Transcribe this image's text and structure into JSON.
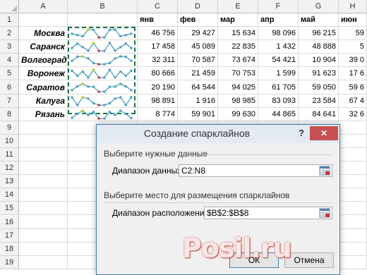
{
  "sheet": {
    "columns": [
      "A",
      "B",
      "C",
      "D",
      "E",
      "F",
      "G",
      "H"
    ],
    "rows": [
      "1",
      "2",
      "3",
      "4",
      "5",
      "6",
      "7",
      "8",
      "9",
      "10",
      "11",
      "12",
      "13",
      "14",
      "15",
      "16",
      "17",
      "18",
      "19"
    ],
    "months": [
      "янв",
      "фев",
      "мар",
      "апр",
      "май",
      "июн"
    ],
    "cities": [
      "Москва",
      "Саранск",
      "Волгоград",
      "Воронеж",
      "Саратов",
      "Калуга",
      "Рязань"
    ],
    "values": [
      [
        "46 756",
        "29 427",
        "15 634",
        "98 096",
        "96 215",
        "59"
      ],
      [
        "17 458",
        "45 089",
        "22 835",
        "1 432",
        "48 888",
        "5"
      ],
      [
        "32 311",
        "70 587",
        "73 674",
        "54 421",
        "10 904",
        "39 0"
      ],
      [
        "80 666",
        "21 459",
        "70 753",
        "1 599",
        "91 623",
        "17 6"
      ],
      [
        "20 190",
        "64 544",
        "94 025",
        "61 705",
        "59 050",
        "59 6"
      ],
      [
        "98 891",
        "1 916",
        "98 985",
        "83 093",
        "23 584",
        "67 4"
      ],
      [
        "8 774",
        "59 901",
        "99 630",
        "44 865",
        "84 641",
        "32 6"
      ]
    ],
    "sparkline_color": "#4a9fbf",
    "high_marker_color": "#c8c800",
    "low_marker_color": "#d03020"
  },
  "dialog": {
    "title": "Создание спарклайнов",
    "help": "?",
    "close": "✕",
    "section1": "Выберите нужные данные",
    "data_range_label": "Диапазон данных:",
    "data_range_value": "C2:N8",
    "section2": "Выберите место для размещения спарклайнов",
    "location_label": "Диапазон расположения:",
    "location_value": "$B$2:$B$8",
    "ok": "ОК",
    "cancel": "Отмена"
  },
  "watermark": "Posil.ru"
}
